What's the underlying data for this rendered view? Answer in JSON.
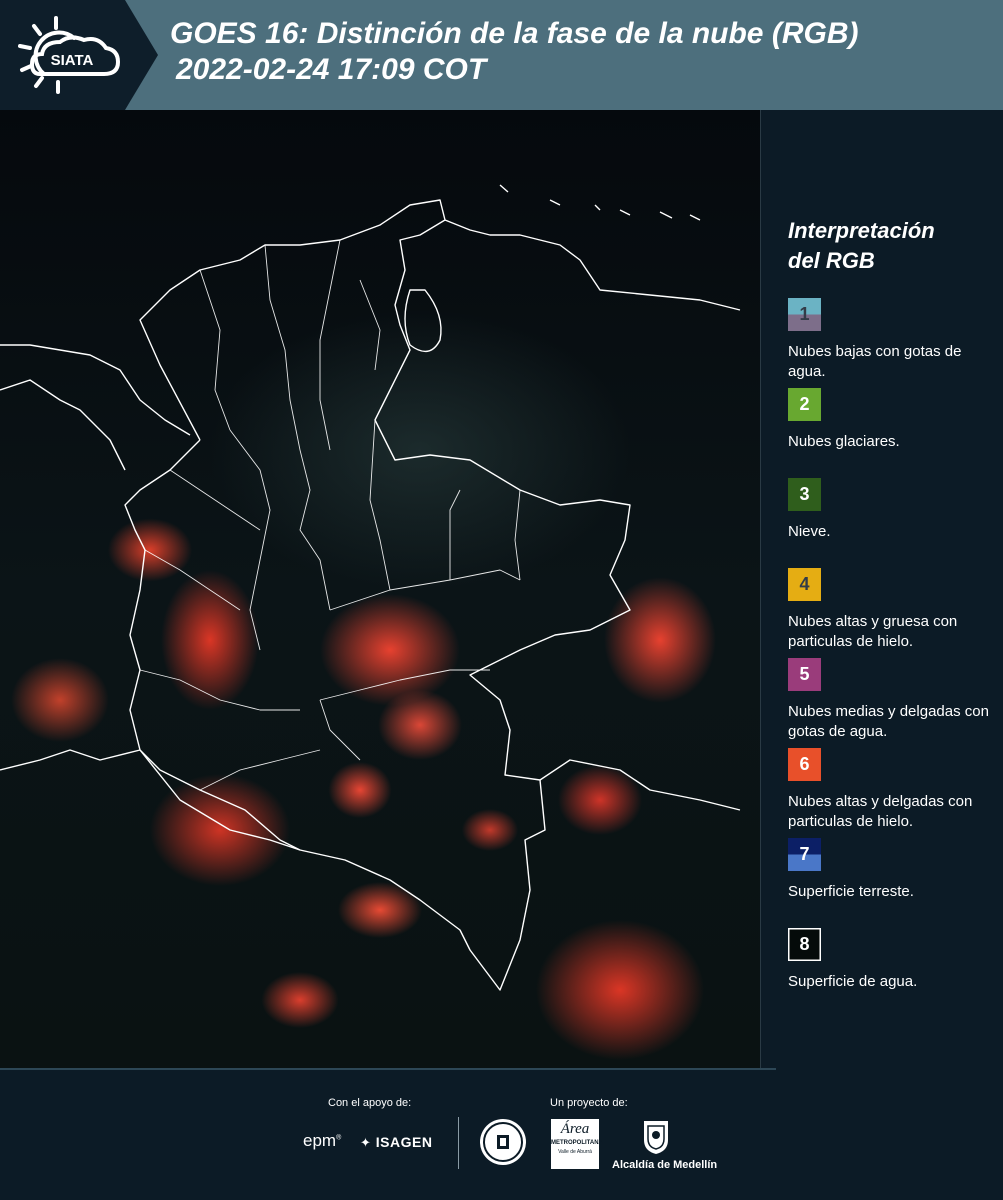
{
  "header": {
    "logo_text": "SIATA",
    "title": "GOES 16: Distinción de la fase de la nube (RGB)",
    "timestamp": "2022-02-24 17:09 COT"
  },
  "legend": {
    "title_line1": "Interpretación",
    "title_line2": "del RGB",
    "items": [
      {
        "number": "1",
        "label": "Nubes bajas con gotas de agua.",
        "color_top": "#6bb3c4",
        "color_bottom": "#7d6e8a"
      },
      {
        "number": "2",
        "label": "Nubes glaciares.",
        "color": "#68a830"
      },
      {
        "number": "3",
        "label": "Nieve.",
        "color": "#2f5e1c"
      },
      {
        "number": "4",
        "label": "Nubes altas y gruesa con particulas de hielo.",
        "color": "#e5ad13"
      },
      {
        "number": "5",
        "label": "Nubes medias y delgadas con gotas de agua.",
        "color": "#9a3c7b"
      },
      {
        "number": "6",
        "label": "Nubes altas y delgadas con particulas de hielo.",
        "color": "#e8502a"
      },
      {
        "number": "7",
        "label": "Superficie terreste.",
        "color_top": "#0c1f66",
        "color_bottom": "#4a77c8"
      },
      {
        "number": "8",
        "label": "Superficie de agua.",
        "color": "#050b0a"
      }
    ]
  },
  "footer": {
    "support_label": "Con el apoyo de:",
    "project_label": "Un proyecto de:",
    "epm": "epm",
    "isagen": "ISAGEN",
    "area_metropolitana_line1": "Área",
    "area_metropolitana_line2": "METROPOLITANA",
    "area_metropolitana_line3": "Valle de Aburrá",
    "alcaldia": "Alcaldía de Medellín"
  }
}
